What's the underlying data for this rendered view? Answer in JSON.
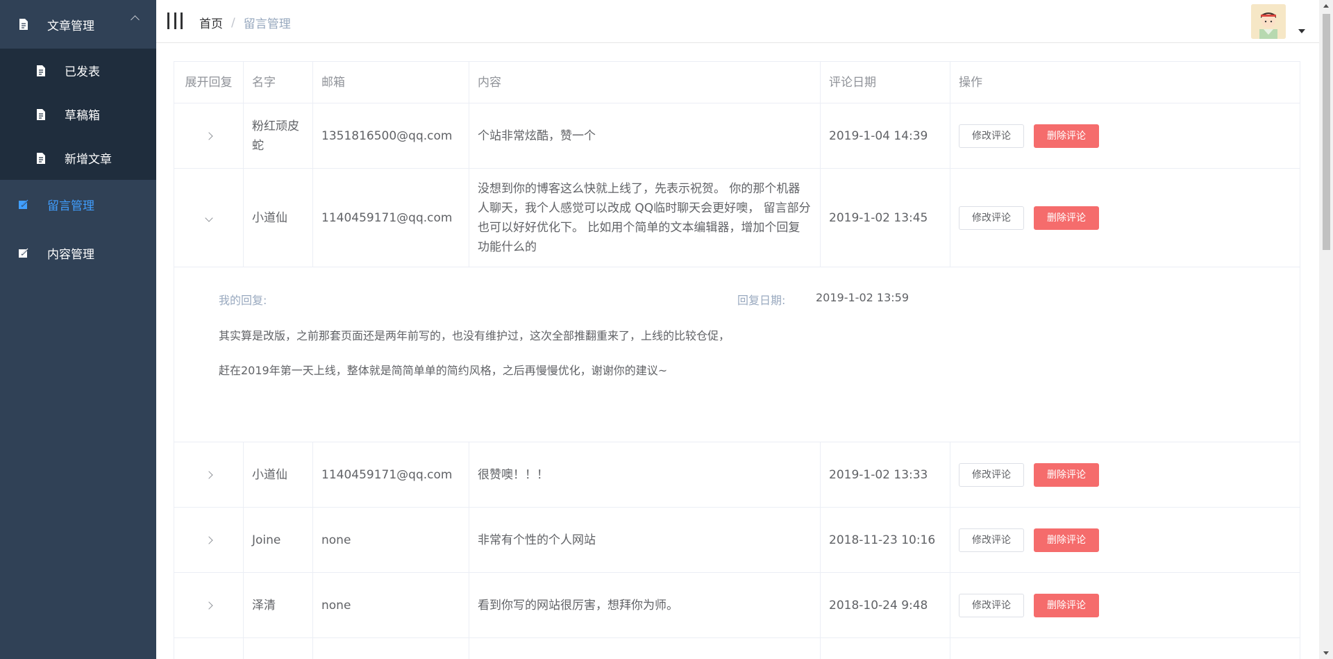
{
  "sidebar": {
    "article_menu": {
      "label": "文章管理"
    },
    "submenu": [
      {
        "label": "已发表"
      },
      {
        "label": "草稿箱"
      },
      {
        "label": "新增文章"
      }
    ],
    "comment_menu": {
      "label": "留言管理"
    },
    "content_menu": {
      "label": "内容管理"
    },
    "colors": {
      "bg": "#304156",
      "submenu_bg": "#1f2d3d",
      "active": "#409eff"
    }
  },
  "header": {
    "breadcrumb": {
      "home": "首页",
      "separator": "/",
      "current": "留言管理"
    }
  },
  "table": {
    "headers": [
      "展开回复",
      "名字",
      "邮箱",
      "内容",
      "评论日期",
      "操作"
    ],
    "edit_label": "修改评论",
    "delete_label": "删除评论",
    "rows": [
      {
        "name": "粉红顽皮蛇",
        "email": "1351816500@qq.com",
        "content": "个站非常炫酷，赞一个",
        "date": "2019-1-04 14:39",
        "expanded": false
      },
      {
        "name": "小道仙",
        "email": "1140459171@qq.com",
        "content": "没想到你的博客这么快就上线了，先表示祝贺。 你的那个机器人聊天，我个人感觉可以改成 QQ临时聊天会更好噢， 留言部分也可以好好优化下。 比如用个简单的文本编辑器，增加个回复功能什么的",
        "date": "2019-1-02 13:45",
        "expanded": true
      },
      {
        "name": "小道仙",
        "email": "1140459171@qq.com",
        "content": "很赞噢！！！",
        "date": "2019-1-02 13:33",
        "expanded": false
      },
      {
        "name": "Joine",
        "email": "none",
        "content": "非常有个性的个人网站",
        "date": "2018-11-23 10:16",
        "expanded": false
      },
      {
        "name": "泽清",
        "email": "none",
        "content": "看到你写的网站很厉害，想拜你为师。",
        "date": "2018-10-24 9:48",
        "expanded": false
      }
    ],
    "expanded_reply": {
      "label": "我的回复:",
      "date_label": "回复日期:",
      "date": "2019-1-02 13:59",
      "text": "其实算是改版，之前那套页面还是两年前写的，也没有维护过，这次全部推翻重来了，上线的比较仓促，赶在2019年第一天上线，整体就是简简单单的简约风格，之后再慢慢优化，谢谢你的建议~"
    },
    "colors": {
      "delete_button": "#f56c6c"
    }
  }
}
